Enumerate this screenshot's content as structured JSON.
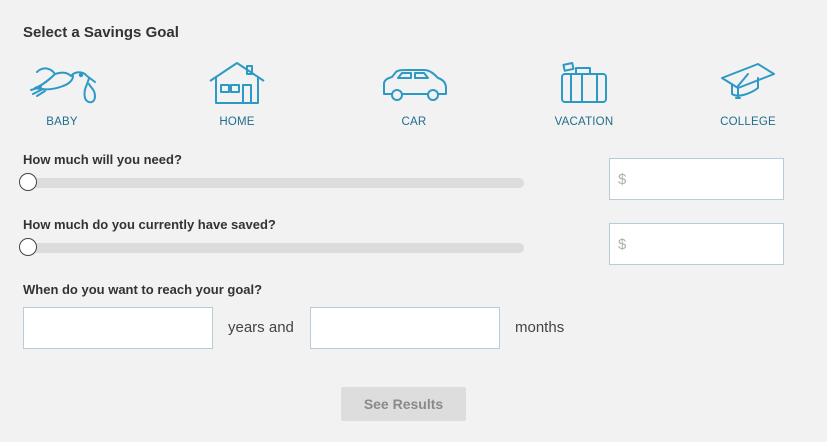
{
  "title": "Select a Savings Goal",
  "goals": [
    {
      "label": "BABY",
      "icon": "stork-icon"
    },
    {
      "label": "HOME",
      "icon": "house-icon"
    },
    {
      "label": "CAR",
      "icon": "car-icon"
    },
    {
      "label": "VACATION",
      "icon": "suitcase-icon"
    },
    {
      "label": "COLLEGE",
      "icon": "graduation-cap-icon"
    }
  ],
  "accent_color": "#2d9ac6",
  "label_color": "#1f6e8c",
  "need": {
    "question": "How much will you need?",
    "slider_value_fraction": 0,
    "placeholder": "$",
    "value": ""
  },
  "saved": {
    "question": "How much do you currently have saved?",
    "slider_value_fraction": 0,
    "placeholder": "$",
    "value": ""
  },
  "timeline": {
    "question": "When do you want to reach your goal?",
    "years_value": "",
    "years_unit": "years and",
    "months_value": "",
    "months_unit": "months"
  },
  "submit_label": "See Results"
}
